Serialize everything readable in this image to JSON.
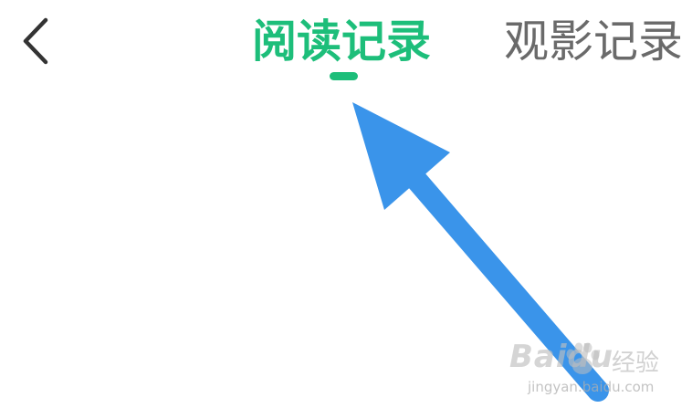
{
  "header": {
    "back_icon": "chevron-left-icon",
    "tabs": [
      {
        "label": "阅读记录",
        "active": true
      },
      {
        "label": "观影记录",
        "active": false
      }
    ],
    "active_color": "#1dbe7a",
    "inactive_color": "#6a6a6a"
  },
  "annotation": {
    "arrow_color": "#3a94ea"
  },
  "watermark": {
    "brand": "Baidu",
    "label": "经验",
    "url": "jingyan.baidu.com"
  }
}
